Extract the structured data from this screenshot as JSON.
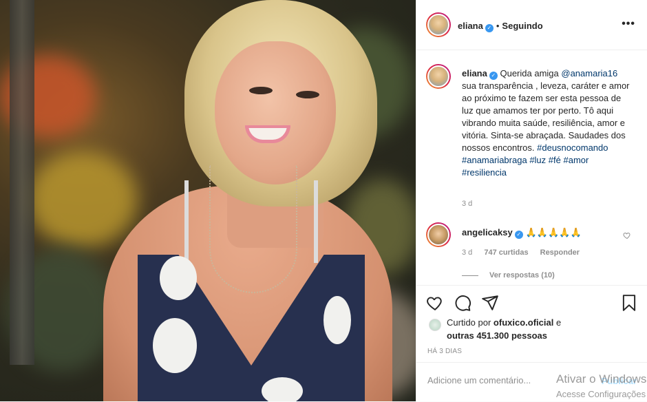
{
  "post": {
    "author": "eliana",
    "follow_status": "Seguindo",
    "more_icon": "•••"
  },
  "caption": {
    "author": "eliana",
    "text_before": "Querida amiga ",
    "mention": "@anamaria16",
    "text_after": " sua transparência , leveza, caráter e amor ao próximo te fazem ser esta pessoa de luz que amamos ter por perto. Tô aqui vibrando muita saúde, resiliência, amor e vitória. Sinta-se abraçada. Saudades dos nossos encontros. ",
    "hashtags": [
      "#deusnocomando",
      "#anamariabraga",
      "#luz",
      "#fé",
      "#amor",
      "#resiliencia"
    ],
    "age": "3 d"
  },
  "comment": {
    "author": "angelicaksy",
    "text": "🙏🙏🙏🙏🙏",
    "age": "3 d",
    "likes": "747 curtidas",
    "reply_label": "Responder",
    "view_replies": "Ver respostas (10)"
  },
  "likes": {
    "prefix": "Curtido por ",
    "user": "ofuxico.oficial",
    "conj": " e",
    "others": "outras 451.300 pessoas"
  },
  "time_ago": "HÁ 3 DIAS",
  "comment_input": {
    "placeholder": "Adicione um comentário...",
    "publish_label": "Publicar"
  },
  "watermark": {
    "line1": "Ativar o Windows",
    "line2": "Acesse Configurações"
  },
  "colors": {
    "link": "#00376b",
    "verified": "#3897f0",
    "muted": "#8e8e8e"
  }
}
